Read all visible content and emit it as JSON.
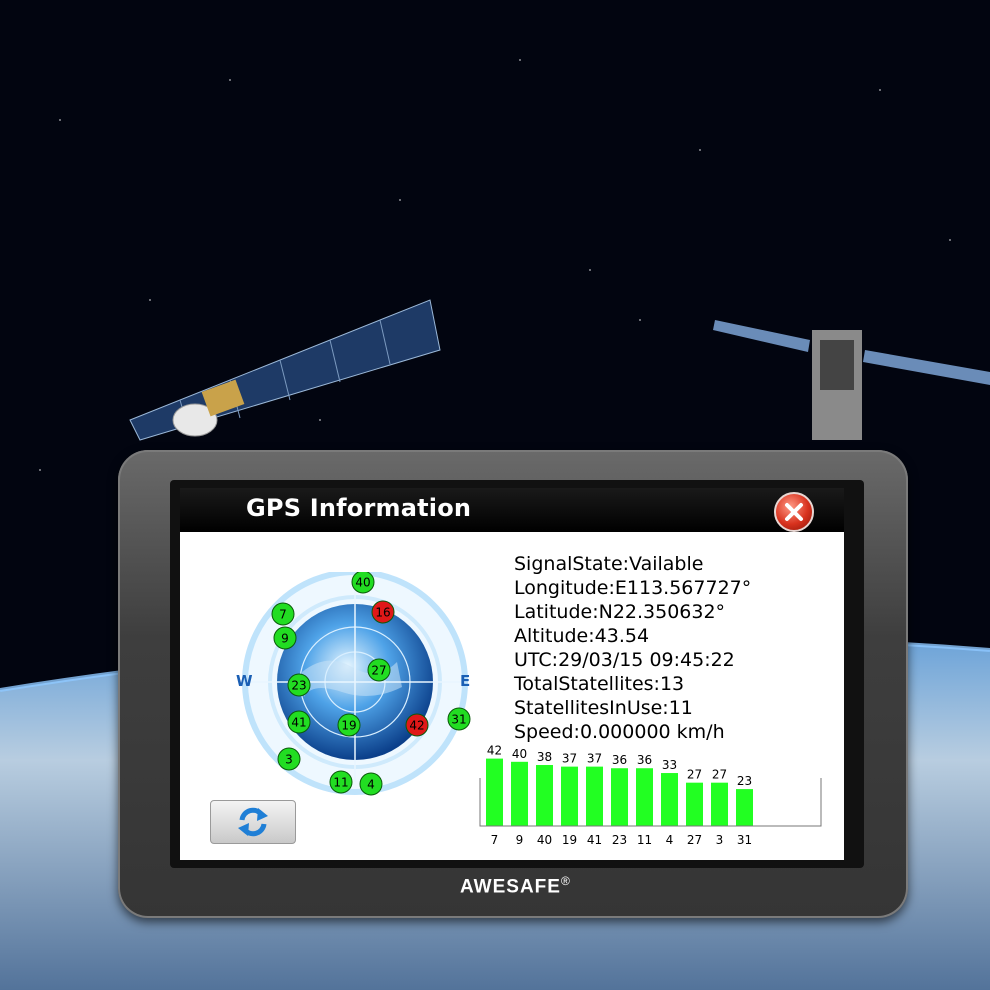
{
  "screen": {
    "title": "GPS Information",
    "brand": "AWESAFE",
    "brand_mark": "®"
  },
  "info": {
    "signal_state": "SignalState:Vailable",
    "longitude": "Longitude:E113.567727°",
    "latitude": "Latitude:N22.350632°",
    "altitude": "Altitude:43.54",
    "utc": "UTC:29/03/15 09:45:22",
    "total_satellites": "TotalStatellites:13",
    "satellites_in_use": "StatellitesInUse:11",
    "speed": "Speed:0.000000 km/h"
  },
  "radar": {
    "west_label": "W",
    "east_label": "E",
    "satellites": [
      {
        "id": "40",
        "status": "in-use"
      },
      {
        "id": "16",
        "status": "not-used"
      },
      {
        "id": "7",
        "status": "in-use"
      },
      {
        "id": "9",
        "status": "in-use"
      },
      {
        "id": "27",
        "status": "in-use"
      },
      {
        "id": "23",
        "status": "in-use"
      },
      {
        "id": "31",
        "status": "in-use"
      },
      {
        "id": "41",
        "status": "in-use"
      },
      {
        "id": "19",
        "status": "in-use"
      },
      {
        "id": "42",
        "status": "not-used"
      },
      {
        "id": "3",
        "status": "in-use"
      },
      {
        "id": "11",
        "status": "in-use"
      },
      {
        "id": "4",
        "status": "in-use"
      }
    ]
  },
  "chart_data": {
    "type": "bar",
    "categories": [
      "7",
      "9",
      "40",
      "19",
      "41",
      "23",
      "11",
      "4",
      "27",
      "3",
      "31"
    ],
    "values": [
      42,
      40,
      38,
      37,
      37,
      36,
      36,
      33,
      27,
      27,
      23
    ],
    "ylim": [
      0,
      50
    ],
    "grid": false
  },
  "colors": {
    "in_use": "#22dd22",
    "not_used": "#e01818",
    "bar": "#22ff22"
  }
}
